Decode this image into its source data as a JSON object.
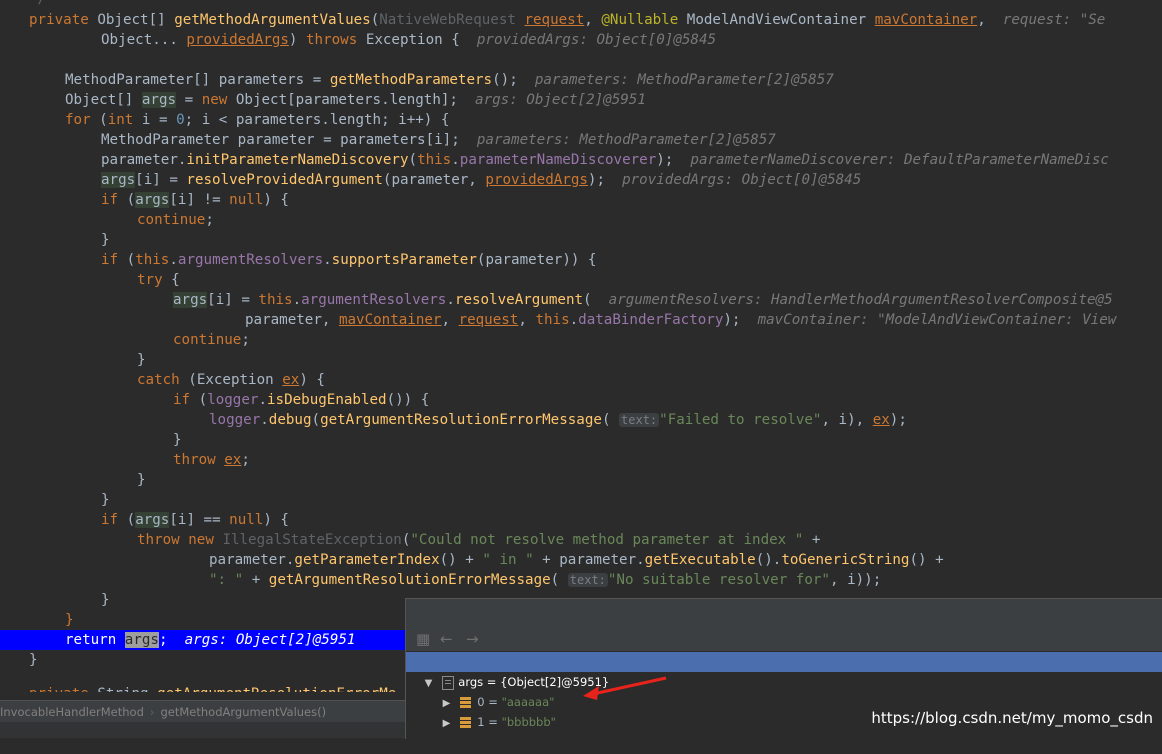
{
  "editor": {
    "line0": {
      "mod": "private",
      "ret_type": "Object[]",
      "method": "getMethodArgumentValues",
      "param1_type": "NativeWebRequest",
      "param1": "request",
      "annotation": "@Nullable",
      "param2_type": "ModelAndViewContainer",
      "param2": "mavContainer",
      "hint": "request: \"Se"
    },
    "line1": {
      "type": "Object...",
      "param": "providedArgs",
      "throws": "throws",
      "exc": "Exception",
      "hint": "providedArgs: Object[0]@5845"
    },
    "line2": {
      "type": "MethodParameter[]",
      "var": "parameters",
      "call": "getMethodParameters",
      "hint": "parameters: MethodParameter[2]@5857"
    },
    "line3": {
      "type": "Object[]",
      "var": "args",
      "new": "new",
      "ctype": "Object",
      "expr": "parameters.length",
      "hint": "args: Object[2]@5951"
    },
    "line4": {
      "kw_for": "for",
      "kw_int": "int",
      "init": "i = ",
      "zero": "0",
      "cond": "; i < parameters.length; i++",
      "open": "{"
    },
    "line5": {
      "type": "MethodParameter",
      "var": "parameter = parameters[i];",
      "hint": "parameters: MethodParameter[2]@5857"
    },
    "line6": {
      "obj": "parameter.",
      "call": "initParameterNameDiscovery",
      "kw_this": "this",
      "field": "parameterNameDiscoverer",
      "hint": "parameterNameDiscoverer: DefaultParameterNameDisc"
    },
    "line7": {
      "var": "args",
      "idx": "[i]",
      "eq": " = ",
      "call": "resolveProvidedArgument",
      "arg1": "parameter, ",
      "arg2": "providedArgs",
      "hint": "providedArgs: Object[0]@5845"
    },
    "line8": {
      "kw_if": "if",
      "var": "args",
      "rest": "[i] != ",
      "kw_null": "null"
    },
    "line9": {
      "kw": "continue"
    },
    "line11": {
      "kw_if": "if",
      "kw_this": "this",
      "field": "argumentResolvers",
      "call": "supportsParameter",
      "arg": "parameter"
    },
    "line12": {
      "kw": "try"
    },
    "line13": {
      "var": "args",
      "idx": "[i]",
      "kw_this": "this",
      "field": "argumentResolvers",
      "call": "resolveArgument",
      "hint": "argumentResolvers: HandlerMethodArgumentResolverComposite@5"
    },
    "line14": {
      "arg1": "parameter, ",
      "arg2": "mavContainer",
      "arg3": "request",
      "kw_this": "this",
      "field": "dataBinderFactory",
      "hint": "mavContainer: \"ModelAndViewContainer: View"
    },
    "line15": {
      "kw": "continue"
    },
    "line17": {
      "kw": "catch",
      "exc": "Exception",
      "var": "ex"
    },
    "line18": {
      "kw_if": "if",
      "field": "logger",
      "call": "isDebugEnabled"
    },
    "line19": {
      "field": "logger",
      "call1": "debug",
      "call2": "getArgumentResolutionErrorMessage",
      "phint": "text:",
      "str": "\"Failed to resolve\"",
      "rest": ", i), ",
      "var": "ex"
    },
    "line21": {
      "kw": "throw",
      "var": "ex"
    },
    "line24": {
      "kw_if": "if",
      "var": "args",
      "rest": "[i] == ",
      "kw_null": "null"
    },
    "line25": {
      "kw_throw": "throw",
      "kw_new": "new",
      "cls": "IllegalStateException",
      "str": "\"Could not resolve method parameter at index \"",
      "plus": " +"
    },
    "line26": {
      "obj": "parameter.",
      "call1": "getParameterIndex",
      "str": "\" in \"",
      "obj2": "parameter.",
      "call2": "getExecutable",
      "call3": "toGenericString"
    },
    "line27": {
      "str1": "\": \"",
      "call": "getArgumentResolutionErrorMessage",
      "phint": "text:",
      "str2": "\"No suitable resolver for\"",
      "rest": ", i));"
    },
    "line30": {
      "kw": "return",
      "var": "args",
      "semi": ";",
      "hint": "args: Object[2]@5951"
    },
    "line32": {
      "mod": "private",
      "type": "String",
      "rest": "getArgumentResolutionErrorMe"
    }
  },
  "breadcrumb": {
    "class_name": "InvocableHandlerMethod",
    "method_name": "getMethodArgumentValues()"
  },
  "debug": {
    "root": {
      "name": "args",
      "value": " = {Object[2]@5951}"
    },
    "items": [
      {
        "index": "0",
        "eq": " = ",
        "value": "\"aaaaaa\""
      },
      {
        "index": "1",
        "eq": " = ",
        "value": "\"bbbbbb\""
      }
    ],
    "watermark": "https://blog.csdn.net/my_momo_csdn",
    "arrow_color": "#e8231b"
  }
}
